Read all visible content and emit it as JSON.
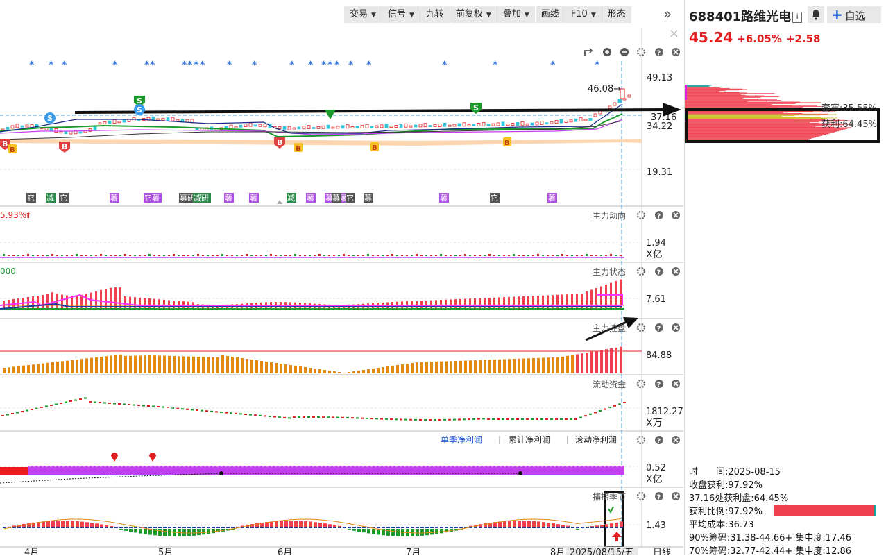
{
  "toolbar": {
    "items": [
      {
        "label": "交易",
        "dropdown": true
      },
      {
        "label": "信号",
        "dropdown": true
      },
      {
        "label": "九转",
        "dropdown": false
      },
      {
        "label": "前复权",
        "dropdown": true
      },
      {
        "label": "叠加",
        "dropdown": true
      },
      {
        "label": "画线",
        "dropdown": false
      },
      {
        "label": "F10",
        "dropdown": true
      },
      {
        "label": "形态",
        "dropdown": false
      }
    ],
    "expand_glyph": "»",
    "close_glyph": "×"
  },
  "stock": {
    "code": "688401",
    "name": "路维光电",
    "info_glyph": "i",
    "add_label": "自选",
    "price": "45.24",
    "change_pct": "+6.05%",
    "change_amt": "+2.58"
  },
  "chips": {
    "cost_label": "套牢:35.55%",
    "profit_label": "获利:64.45%",
    "stats": [
      "时　　间:2025-08-15",
      "收盘获利:97.92%",
      "37.16处获利盘:64.45%",
      "获利比例:97.92%",
      "平均成本:36.73",
      "90%筹码:31.38-44.66+ 集中度:17.46",
      "70%筹码:32.77-42.44+ 集中度:12.86"
    ],
    "profit_ratio": 0.9792
  },
  "main_chart": {
    "high_label": "46.08→",
    "y_labels": [
      "49.13",
      "37.16",
      "34.22",
      "19.31"
    ],
    "signal_s": "S",
    "signal_b": "B",
    "tags": [
      "它",
      "减",
      "它",
      "薯",
      "它薯",
      "募研",
      "减研",
      "薯",
      "薯",
      "减",
      "薯",
      "募募薯",
      "募",
      "它",
      "募",
      "薯",
      "它",
      "薯"
    ]
  },
  "panels": [
    {
      "title": "主力动向",
      "left_label": "5.93%",
      "arrow": "⬆",
      "value": "1.94",
      "unit": "X亿"
    },
    {
      "title": "主力状态",
      "left_label": "000",
      "value": "7.61",
      "unit": ""
    },
    {
      "title": "主力控盘",
      "left_label": "",
      "value": "84.88",
      "unit": ""
    },
    {
      "title": "流动资金",
      "left_label": "",
      "value": "1812.27",
      "unit": "X万"
    },
    {
      "title": "",
      "left_label": "",
      "value": "0.52",
      "unit": "X亿"
    },
    {
      "title": "捕捞季节",
      "left_label": "",
      "value": "1.43",
      "unit": ""
    }
  ],
  "profit_tabs": [
    "单季净利润",
    "累计净利润",
    "滚动净利润"
  ],
  "x_axis": {
    "months": [
      "4月",
      "5月",
      "6月",
      "7月",
      "8月"
    ],
    "current_date": "2025/08/15/五",
    "period": "日线"
  },
  "colors": {
    "up": "#e02020",
    "down": "#1a9a2a",
    "accent": "#1a56d6",
    "purple": "#c040f0",
    "orange": "#e08a10"
  }
}
